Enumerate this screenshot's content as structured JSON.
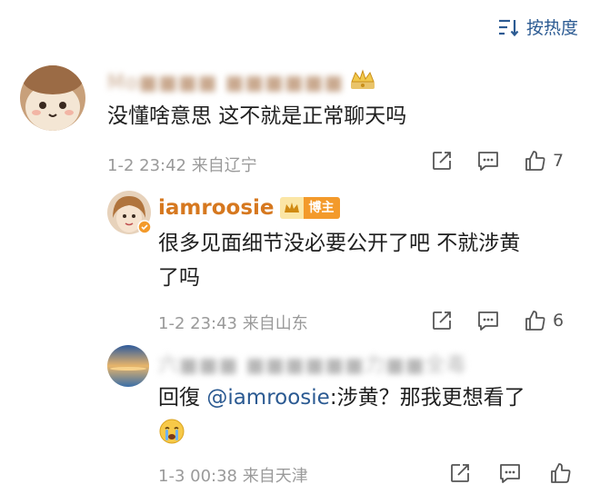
{
  "sort": {
    "label": "按热度",
    "icon": "sort-lines-icon"
  },
  "comments": [
    {
      "username": "Mo■■■■ ■■■■■■",
      "badge": "crown-icon",
      "text": "没懂啥意思 这不就是正常聊天吗",
      "time": "1-2 23:42 来自辽宁",
      "likes": "7"
    },
    {
      "username": "iamroosie",
      "badge_label": "博主",
      "text_line1": "很多见面细节没必要公开了吧 不就涉黄",
      "text_line2": "了吗",
      "time": "1-2 23:43 来自山东",
      "likes": "6"
    },
    {
      "username": "六■■■ ■■■■■■力■■全毒",
      "reply_prefix": "回復",
      "mention": "@iamroosie",
      "text": ":涉黄？那我更想看了",
      "emoji": "crying-face-emoji",
      "time": "1-3 00:38 来自天津",
      "likes": ""
    }
  ],
  "colors": {
    "accent": "#2b5a92",
    "author": "#d6781f",
    "meta": "#9a9a9a"
  }
}
